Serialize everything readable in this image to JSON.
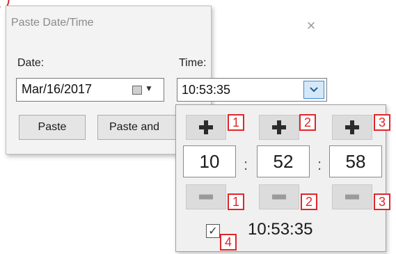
{
  "corner_mark": "( )",
  "dialog": {
    "title": "Paste Date/Time",
    "close_glyph": "×",
    "date_label": "Date:",
    "date_value": "Mar/16/2017",
    "time_label": "Time:",
    "time_value": "10:53:35",
    "paste_label": "Paste",
    "paste_and_label": "Paste and"
  },
  "picker": {
    "fields": [
      {
        "value": "10",
        "tag": "1"
      },
      {
        "value": "52",
        "tag": "2"
      },
      {
        "value": "58",
        "tag": "3"
      }
    ],
    "separator": ":",
    "check_tag": "4",
    "check_time": "10:53:35",
    "checked": true,
    "check_glyph": "✓"
  },
  "icons": {
    "calendar": "calendar-icon",
    "date_dropdown": "chevron-down-icon",
    "time_dropdown": "chevron-down-icon",
    "close": "close-icon"
  },
  "colors": {
    "tag_red": "#e0262a",
    "dropdown_accent": "#3a8ad0"
  }
}
